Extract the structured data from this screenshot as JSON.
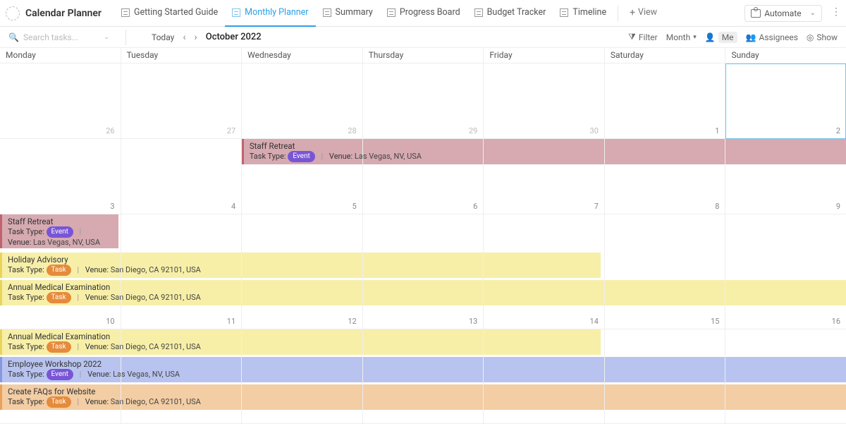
{
  "app": {
    "title": "Calendar Planner"
  },
  "tabs": [
    {
      "label": "Getting Started Guide"
    },
    {
      "label": "Monthly Planner"
    },
    {
      "label": "Summary"
    },
    {
      "label": "Progress Board"
    },
    {
      "label": "Budget Tracker"
    },
    {
      "label": "Timeline"
    }
  ],
  "addview": {
    "label": "View"
  },
  "automate": {
    "label": "Automate"
  },
  "toolbar": {
    "search_placeholder": "Search tasks...",
    "today": "Today",
    "month_label": "October 2022",
    "filter": "Filter",
    "range": "Month",
    "me": "Me",
    "assignees": "Assignees",
    "show": "Show"
  },
  "days": [
    "Monday",
    "Tuesday",
    "Wednesday",
    "Thursday",
    "Friday",
    "Saturday",
    "Sunday"
  ],
  "weeks": [
    {
      "dates": [
        "26",
        "27",
        "28",
        "29",
        "30",
        "1",
        "2"
      ],
      "muted": [
        true,
        true,
        true,
        true,
        true,
        false,
        false
      ],
      "today_index": 6
    },
    {
      "dates": [
        "3",
        "4",
        "5",
        "6",
        "7",
        "8",
        "9"
      ]
    },
    {
      "dates": [
        "10",
        "11",
        "12",
        "13",
        "14",
        "15",
        "16"
      ]
    }
  ],
  "labels": {
    "task_type": "Task Type:",
    "venue": "Venue:"
  },
  "badges": {
    "event": "Event",
    "task": "Task"
  },
  "ev": {
    "staff_retreat": {
      "title": "Staff Retreat",
      "venue": "Las Vegas, NV, USA"
    },
    "holiday_advisory": {
      "title": "Holiday Advisory",
      "venue": "San Diego, CA 92101, USA"
    },
    "annual_medical": {
      "title": "Annual Medical Examination",
      "venue": "San Diego, CA 92101, USA"
    },
    "employee_workshop": {
      "title": "Employee Workshop 2022",
      "venue": "Las Vegas, NV, USA"
    },
    "create_faqs": {
      "title": "Create FAQs for Website",
      "venue": "San Diego, CA 92101, USA"
    }
  }
}
